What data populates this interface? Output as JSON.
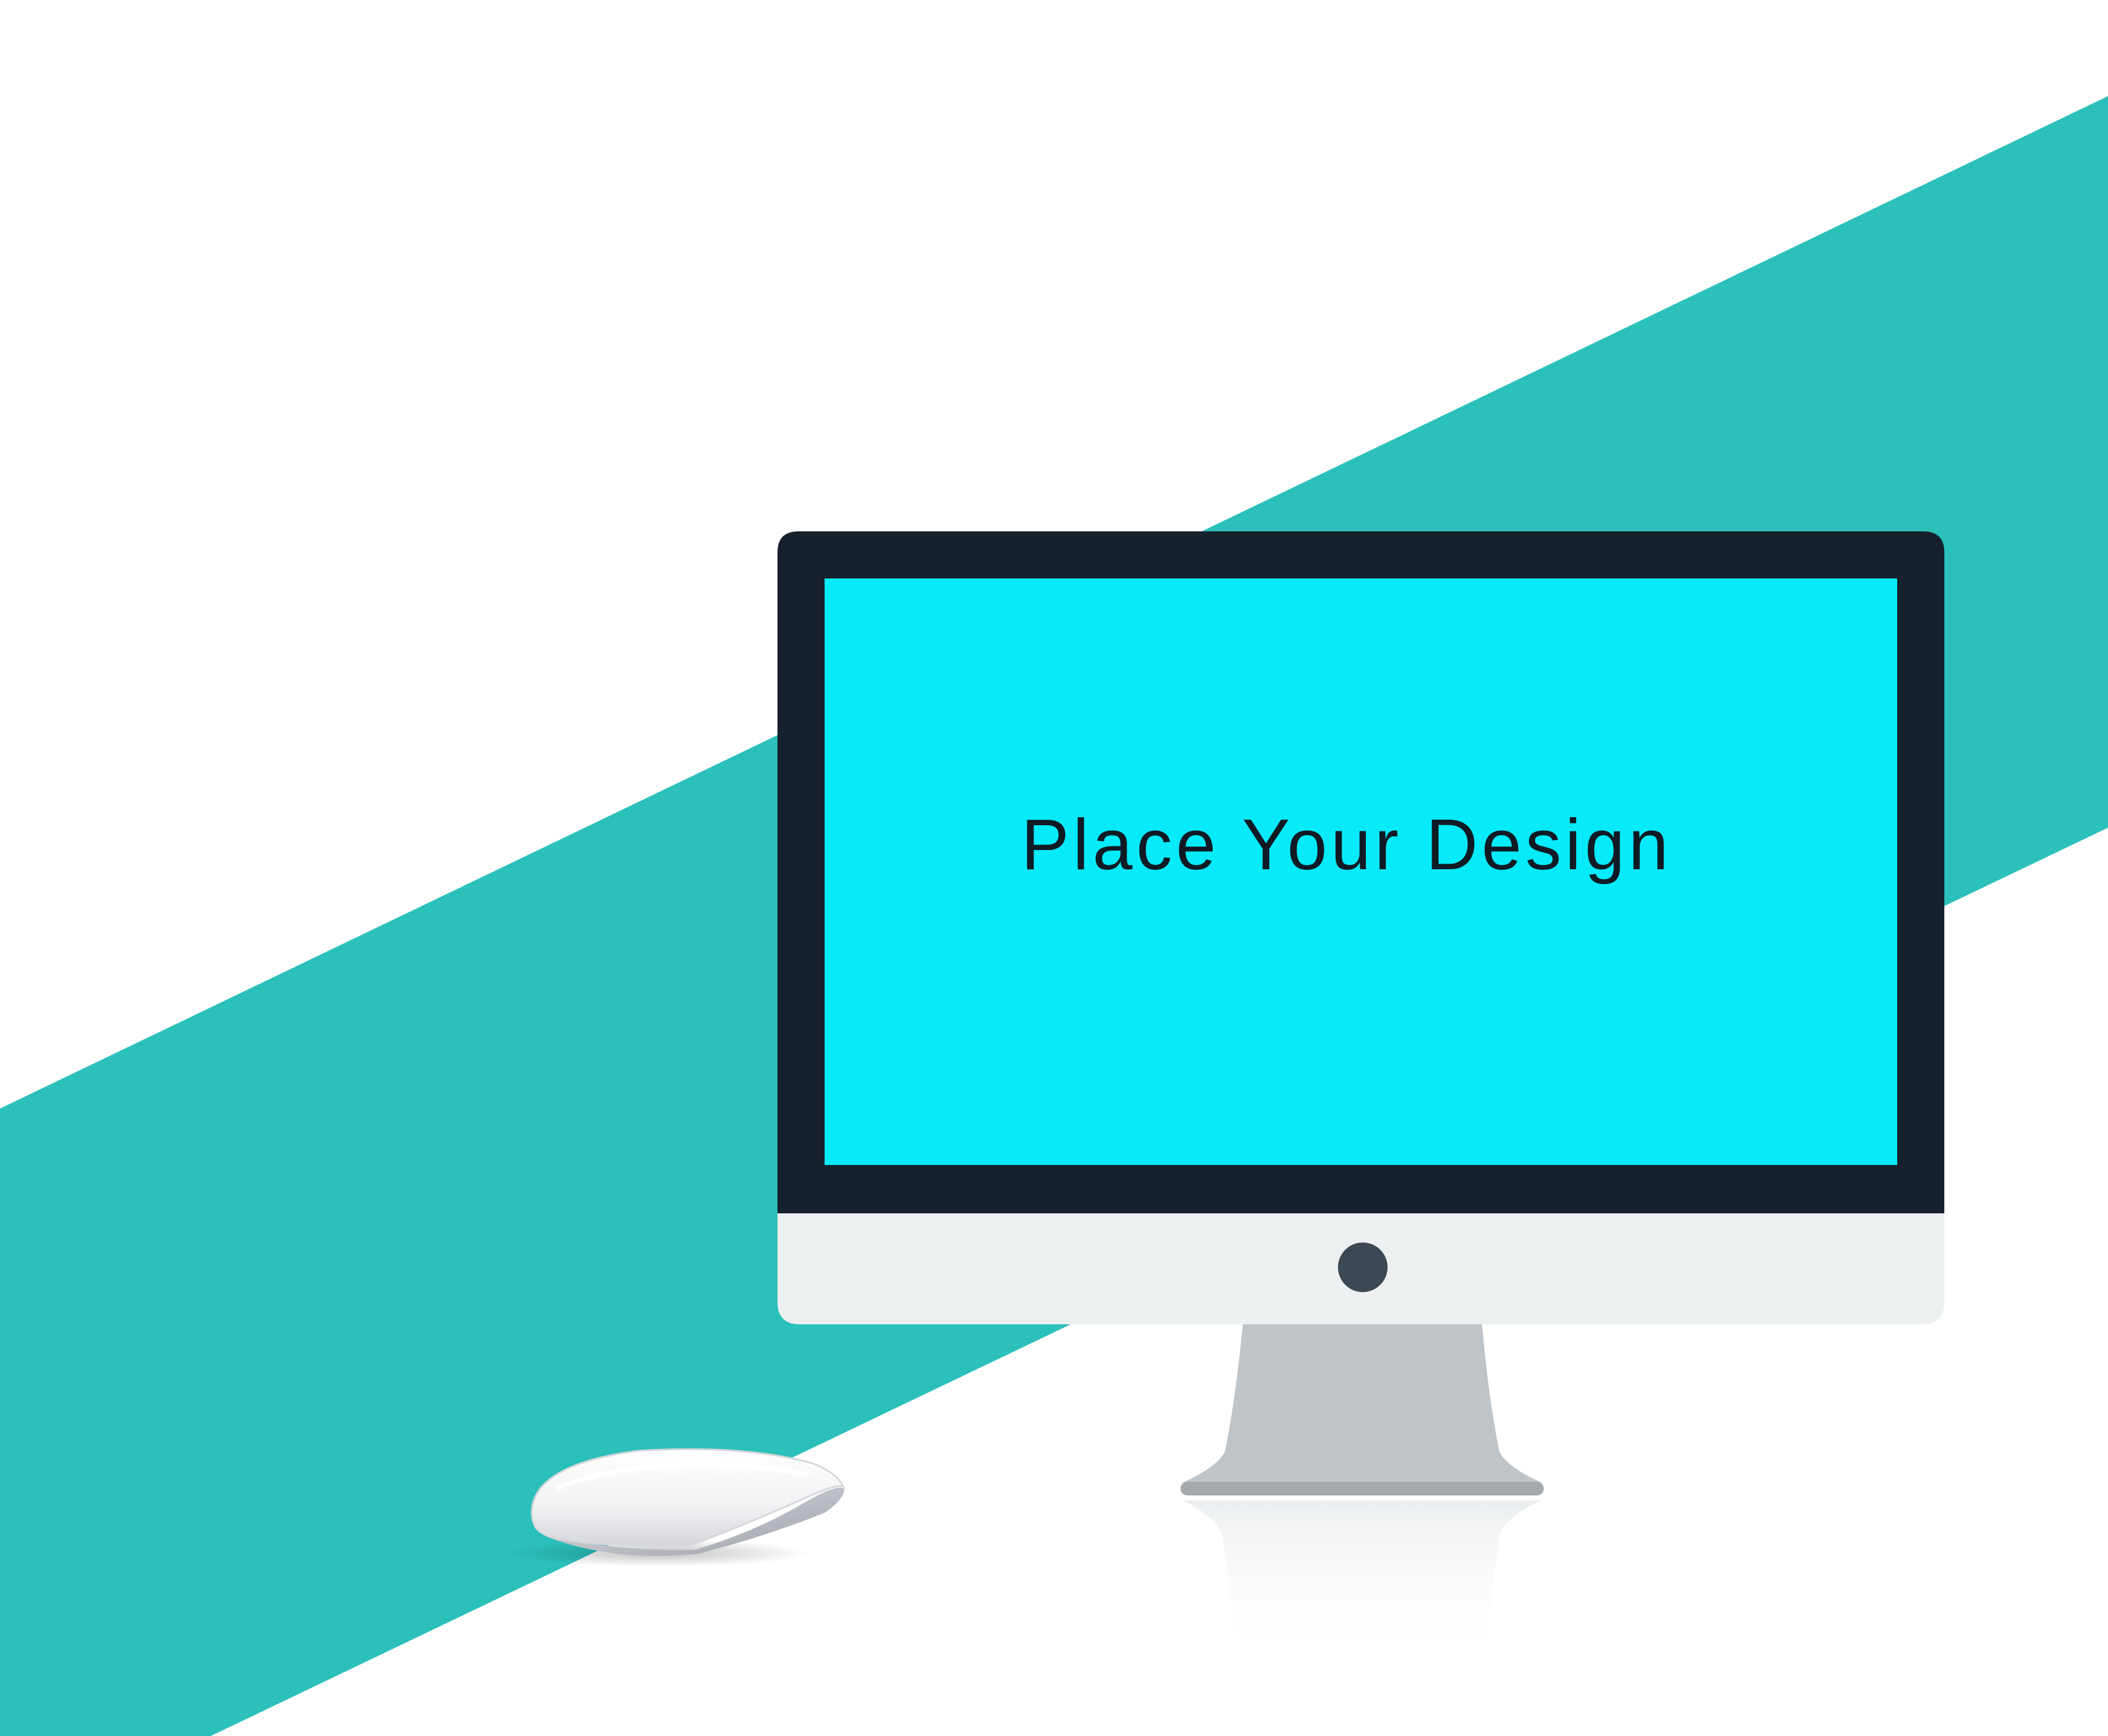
{
  "screen": {
    "placeholder_text": "Place Your Design"
  },
  "colors": {
    "background": "#ffffff",
    "stripe": "#2bc0ba",
    "bezel": "#16212d",
    "screen": "#07eaf9",
    "chin": "#edf0f1",
    "camera_button": "#3c4954",
    "stand": "#bfc4c8",
    "text": "#101a24"
  },
  "icons": {
    "monitor": "monitor-icon",
    "mouse": "mouse-icon"
  }
}
